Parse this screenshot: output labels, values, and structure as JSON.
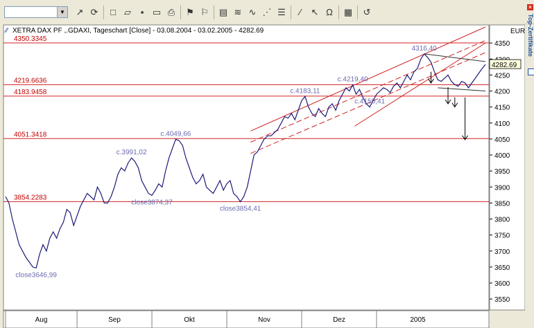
{
  "toolbar": {
    "symbol_value": "",
    "buttons": [
      "draw-icon",
      "refresh-icon",
      "new-icon",
      "open-icon",
      "save-icon",
      "copy-icon",
      "print-icon",
      "flag-icon",
      "flag2-icon",
      "chart-type-icon",
      "indicator-icon",
      "study-icon",
      "trend-icon",
      "properties-icon",
      "line-tool-icon",
      "cursor-icon",
      "magnet-icon",
      "layout-icon",
      "undo-icon"
    ]
  },
  "side_panel": {
    "currency": "EUR",
    "vertical_text": "Top-Zertifikate"
  },
  "chart_data": {
    "type": "line",
    "title": "XETRA DAX PF ,.GDAXI, Tageschart [Close] - 03.08.2004 - 03.02.2005 - 4282.69",
    "last_value": "4282.69",
    "ylim": [
      3520,
      4400
    ],
    "y_ticks": [
      "4350",
      "4300",
      "4250",
      "4200",
      "4150",
      "4100",
      "4050",
      "4000",
      "3950",
      "3900",
      "3850",
      "3800",
      "3750",
      "3700",
      "3650",
      "3600",
      "3550"
    ],
    "x_ticks": [
      "Aug",
      "Sep",
      "Okt",
      "Nov",
      "Dez",
      "2005"
    ],
    "series": [
      {
        "values": [
          3870,
          3850,
          3800,
          3760,
          3720,
          3700,
          3680,
          3665,
          3650,
          3647,
          3690,
          3720,
          3700,
          3740,
          3760,
          3740,
          3770,
          3790,
          3830,
          3820,
          3780,
          3810,
          3840,
          3860,
          3880,
          3870,
          3860,
          3900,
          3880,
          3850,
          3850,
          3870,
          3900,
          3940,
          3960,
          3950,
          3975,
          3991,
          3980,
          3960,
          3920,
          3900,
          3880,
          3874,
          3890,
          3910,
          3900,
          3950,
          3990,
          4020,
          4049,
          4045,
          4030,
          3990,
          3960,
          3930,
          3910,
          3920,
          3940,
          3900,
          3890,
          3880,
          3900,
          3920,
          3890,
          3910,
          3920,
          3880,
          3870,
          3854,
          3870,
          3900,
          3950,
          4000,
          4010,
          4030,
          4050,
          4060,
          4060,
          4070,
          4080,
          4100,
          4120,
          4115,
          4130,
          4110,
          4140,
          4170,
          4183,
          4150,
          4130,
          4120,
          4145,
          4130,
          4120,
          4150,
          4160,
          4140,
          4170,
          4190,
          4210,
          4200,
          4219,
          4190,
          4205,
          4180,
          4160,
          4150,
          4170,
          4190,
          4200,
          4210,
          4205,
          4195,
          4215,
          4225,
          4210,
          4230,
          4250,
          4235,
          4260,
          4270,
          4300,
          4316,
          4305,
          4290,
          4260,
          4235,
          4230,
          4240,
          4250,
          4230,
          4220,
          4215,
          4230,
          4225,
          4210,
          4225,
          4240,
          4255,
          4270,
          4283
        ]
      }
    ],
    "horizontal_lines": [
      {
        "value": 4350.3345,
        "label": "4350.3345"
      },
      {
        "value": 4219.6636,
        "label": "4219.6636"
      },
      {
        "value": 4183.9458,
        "label": "4183.9458"
      },
      {
        "value": 4051.3418,
        "label": "4051.3418"
      },
      {
        "value": 3854.2283,
        "label": "3854.2283"
      }
    ],
    "annotations": [
      {
        "text": "close3646,99",
        "series_index": 9
      },
      {
        "text": "c.3991,02",
        "series_index": 37
      },
      {
        "text": "close3874,37",
        "series_index": 43
      },
      {
        "text": "c.4049,66",
        "series_index": 50
      },
      {
        "text": "close3854,41",
        "series_index": 69
      },
      {
        "text": "c.4183,11",
        "series_index": 88
      },
      {
        "text": "c.4219,40",
        "series_index": 102
      },
      {
        "text": "c.4150,41",
        "series_index": 107
      },
      {
        "text": "4316,40",
        "series_index": 123
      }
    ]
  }
}
